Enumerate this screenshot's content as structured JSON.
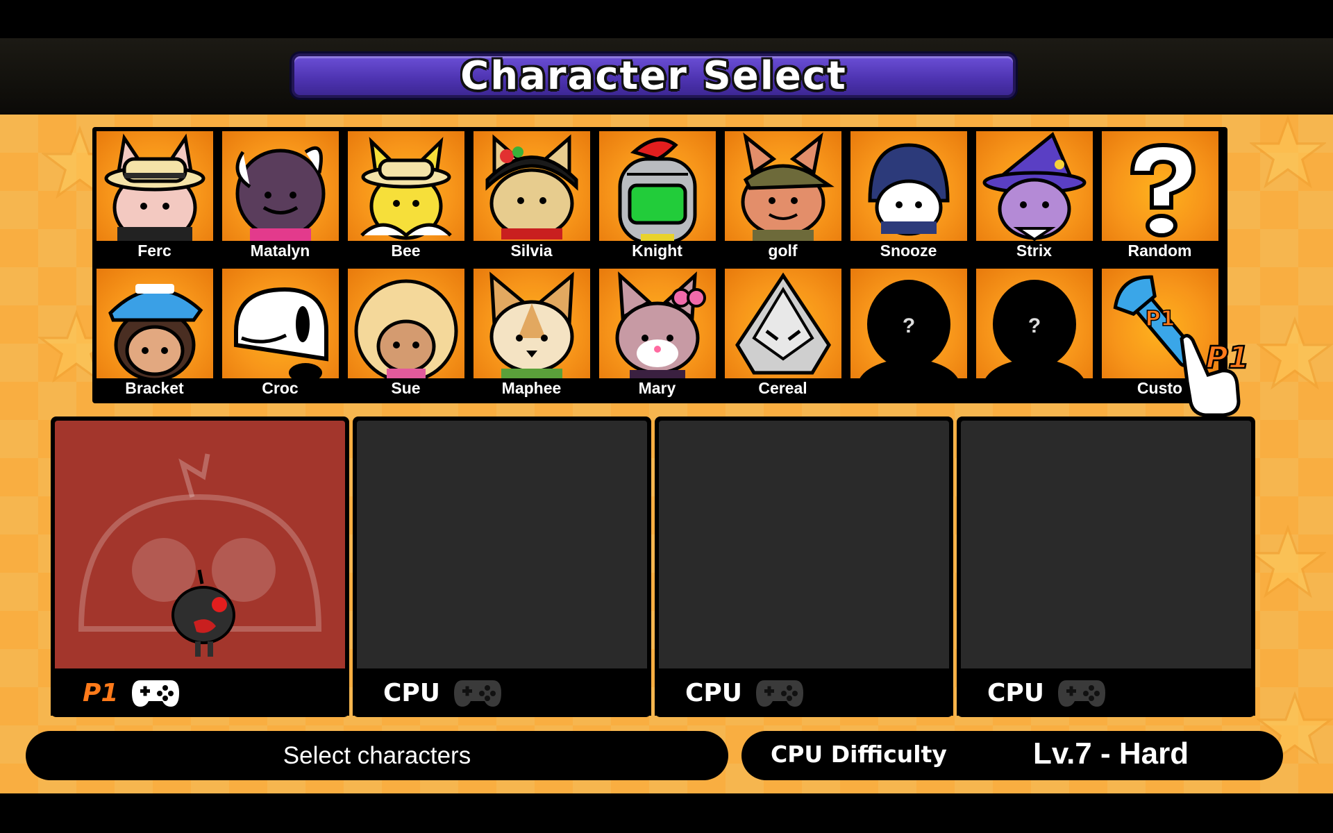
{
  "header": {
    "title": "Character Select"
  },
  "roster": {
    "row1": [
      "Ferc",
      "Matalyn",
      "Bee",
      "Silvia",
      "Knight",
      "golf",
      "Snooze",
      "Strix",
      "Random"
    ],
    "row2": [
      "Bracket",
      "Croc",
      "Sue",
      "Maphee",
      "Mary",
      "Cereal",
      "",
      "",
      "Custo"
    ],
    "locked_mark": "?"
  },
  "cursor": {
    "player_tag": "P1",
    "token_tag": "P1"
  },
  "slots": [
    {
      "label": "P1",
      "state": "selected"
    },
    {
      "label": "CPU",
      "state": "empty"
    },
    {
      "label": "CPU",
      "state": "empty"
    },
    {
      "label": "CPU",
      "state": "empty"
    }
  ],
  "status": {
    "message": "Select characters"
  },
  "difficulty": {
    "label": "CPU Difficulty",
    "value": "Lv.7 - Hard"
  },
  "colors": {
    "title_plate": "#5a3fc4",
    "portrait_bg": "#f7951a",
    "p1_accent": "#ff7a1a",
    "p1_slot_bg": "#a3362c",
    "cpu_slot_bg": "#2a2a2a",
    "stage_bg": "#f6b64f"
  },
  "icons": {
    "controller": "gamepad-icon",
    "cursor": "pointing-hand-icon",
    "locked": "silhouette-icon",
    "random": "question-mark-icon",
    "custom": "wrench-icon"
  }
}
